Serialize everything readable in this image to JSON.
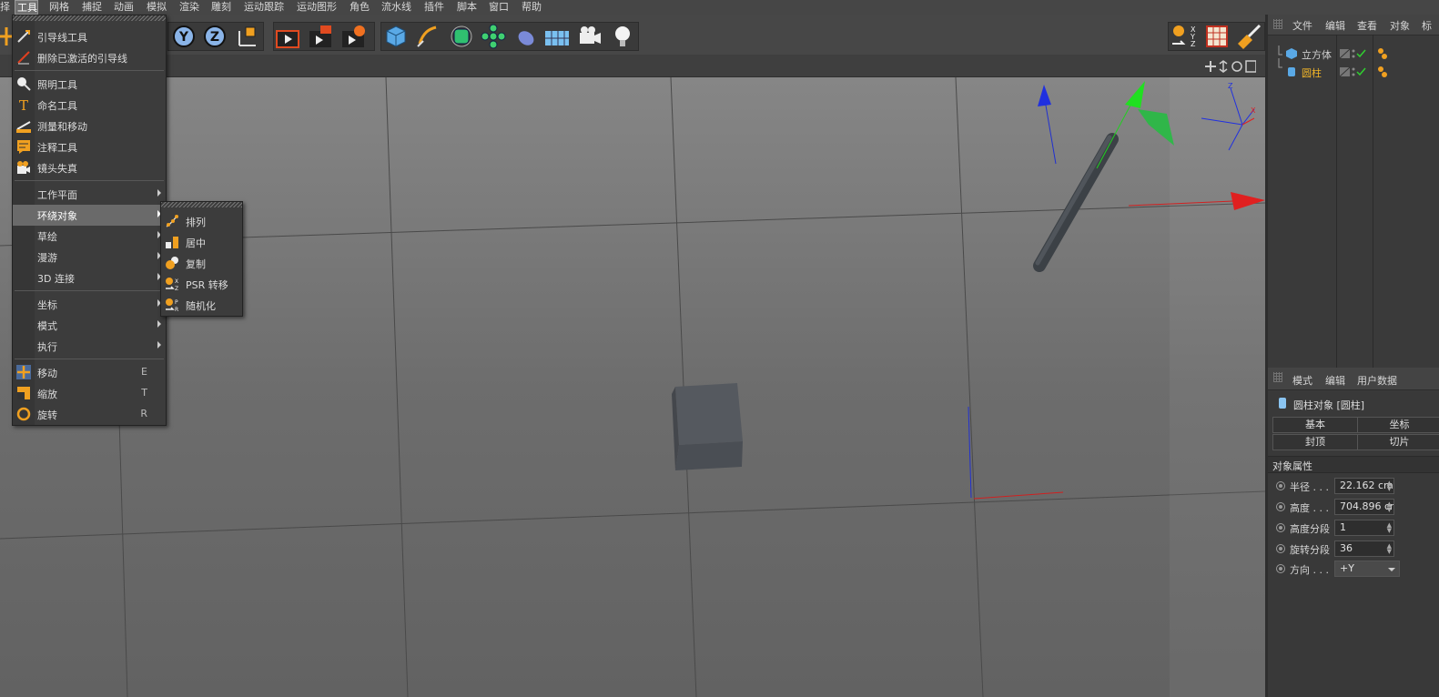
{
  "menubar": {
    "items": [
      "择",
      "工具",
      "网格",
      "捕捉",
      "动画",
      "模拟",
      "渲染",
      "雕刻",
      "运动跟踪",
      "运动图形",
      "角色",
      "流水线",
      "插件",
      "脚本",
      "窗口",
      "帮助"
    ],
    "active_index": 1
  },
  "toolbar": {
    "axis_y": "Y",
    "axis_z": "Z"
  },
  "tools_menu": {
    "items": [
      {
        "label": "引导线工具",
        "icon": "guide-tool-icon"
      },
      {
        "label": "删除已激活的引导线",
        "icon": "delete-guide-icon"
      },
      {
        "label": "照明工具",
        "icon": "lighting-tool-icon"
      },
      {
        "label": "命名工具",
        "icon": "naming-tool-icon"
      },
      {
        "label": "测量和移动",
        "icon": "measure-move-icon"
      },
      {
        "label": "注释工具",
        "icon": "annotation-tool-icon"
      },
      {
        "label": "镜头失真",
        "icon": "lens-distortion-icon"
      },
      {
        "label": "工作平面"
      },
      {
        "label": "环绕对象"
      },
      {
        "label": "草绘"
      },
      {
        "label": "漫游"
      },
      {
        "label": "3D 连接"
      },
      {
        "label": "坐标"
      },
      {
        "label": "模式"
      },
      {
        "label": "执行"
      },
      {
        "label": "移动",
        "shortcut": "E",
        "icon": "move-icon"
      },
      {
        "label": "缩放",
        "shortcut": "T",
        "icon": "scale-icon"
      },
      {
        "label": "旋转",
        "shortcut": "R",
        "icon": "rotate-icon"
      }
    ]
  },
  "arrange_menu": {
    "items": [
      {
        "label": "排列",
        "icon": "arrange-icon"
      },
      {
        "label": "居中",
        "icon": "center-icon"
      },
      {
        "label": "复制",
        "icon": "duplicate-icon"
      },
      {
        "label": "PSR 转移",
        "icon": "psr-transfer-icon"
      },
      {
        "label": "随机化",
        "icon": "randomize-icon"
      }
    ]
  },
  "object_manager": {
    "tabs": [
      "文件",
      "编辑",
      "查看",
      "对象",
      "标"
    ],
    "objects": [
      {
        "name": "立方体",
        "color": "#d8d8d8"
      },
      {
        "name": "圆柱",
        "color": "#f0b429"
      }
    ]
  },
  "attribute_manager": {
    "tabs": [
      "模式",
      "编辑",
      "用户数据"
    ],
    "object_title": "圆柱对象 [圆柱]",
    "buttons": [
      "基本",
      "坐标",
      "封顶",
      "切片"
    ],
    "section_title": "对象属性",
    "properties": [
      {
        "label": "半径 . . .",
        "value": "22.162 cm"
      },
      {
        "label": "高度 . . .",
        "value": "704.896 cm"
      },
      {
        "label": "高度分段",
        "value": "1"
      },
      {
        "label": "旋转分段",
        "value": "36"
      },
      {
        "label": "方向 . . .",
        "value": "+Y"
      }
    ]
  },
  "colors": {
    "accent_orange": "#f0a020",
    "axis_x": "#e02020",
    "axis_y": "#20d020",
    "axis_z": "#2020e0"
  }
}
